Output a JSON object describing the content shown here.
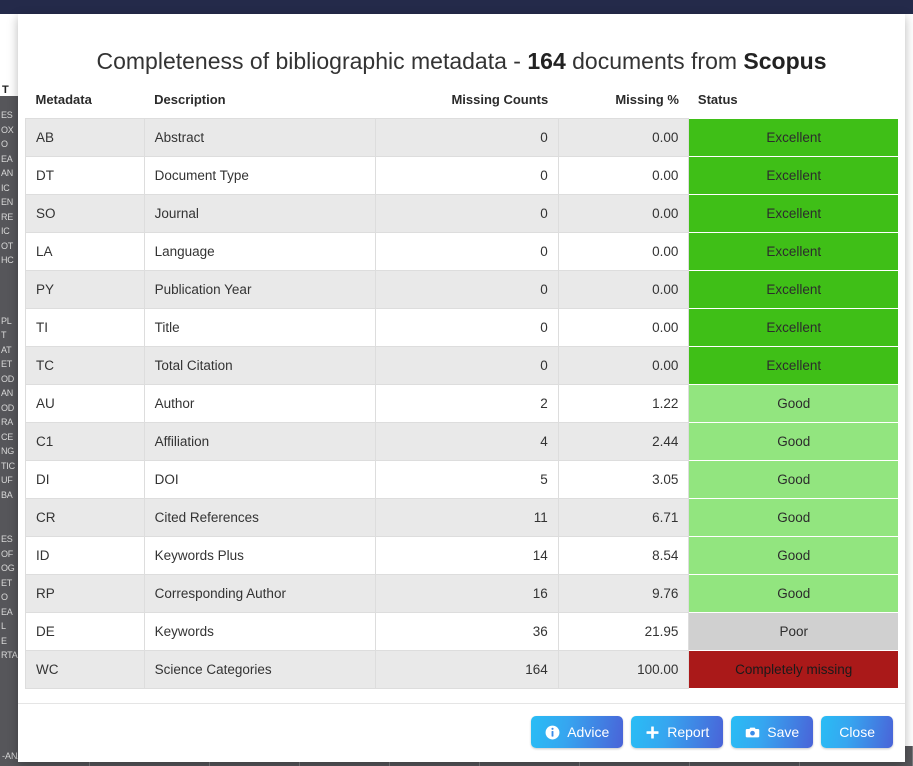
{
  "modal": {
    "title_prefix": "Completeness of bibliographic metadata - ",
    "title_count": "164",
    "title_mid": " documents from ",
    "title_source": "Scopus"
  },
  "table": {
    "columns": [
      "Metadata",
      "Description",
      "Missing Counts",
      "Missing %",
      "Status"
    ],
    "rows": [
      {
        "metadata": "AB",
        "description": "Abstract",
        "missing_counts": "0",
        "missing_pct": "0.00",
        "status": "Excellent",
        "color": "#3fbf17"
      },
      {
        "metadata": "DT",
        "description": "Document Type",
        "missing_counts": "0",
        "missing_pct": "0.00",
        "status": "Excellent",
        "color": "#3fbf17"
      },
      {
        "metadata": "SO",
        "description": "Journal",
        "missing_counts": "0",
        "missing_pct": "0.00",
        "status": "Excellent",
        "color": "#3fbf17"
      },
      {
        "metadata": "LA",
        "description": "Language",
        "missing_counts": "0",
        "missing_pct": "0.00",
        "status": "Excellent",
        "color": "#3fbf17"
      },
      {
        "metadata": "PY",
        "description": "Publication Year",
        "missing_counts": "0",
        "missing_pct": "0.00",
        "status": "Excellent",
        "color": "#3fbf17"
      },
      {
        "metadata": "TI",
        "description": "Title",
        "missing_counts": "0",
        "missing_pct": "0.00",
        "status": "Excellent",
        "color": "#3fbf17"
      },
      {
        "metadata": "TC",
        "description": "Total Citation",
        "missing_counts": "0",
        "missing_pct": "0.00",
        "status": "Excellent",
        "color": "#3fbf17"
      },
      {
        "metadata": "AU",
        "description": "Author",
        "missing_counts": "2",
        "missing_pct": "1.22",
        "status": "Good",
        "color": "#92e57f"
      },
      {
        "metadata": "C1",
        "description": "Affiliation",
        "missing_counts": "4",
        "missing_pct": "2.44",
        "status": "Good",
        "color": "#92e57f"
      },
      {
        "metadata": "DI",
        "description": "DOI",
        "missing_counts": "5",
        "missing_pct": "3.05",
        "status": "Good",
        "color": "#92e57f"
      },
      {
        "metadata": "CR",
        "description": "Cited References",
        "missing_counts": "11",
        "missing_pct": "6.71",
        "status": "Good",
        "color": "#92e57f"
      },
      {
        "metadata": "ID",
        "description": "Keywords Plus",
        "missing_counts": "14",
        "missing_pct": "8.54",
        "status": "Good",
        "color": "#92e57f"
      },
      {
        "metadata": "RP",
        "description": "Corresponding Author",
        "missing_counts": "16",
        "missing_pct": "9.76",
        "status": "Good",
        "color": "#92e57f"
      },
      {
        "metadata": "DE",
        "description": "Keywords",
        "missing_counts": "36",
        "missing_pct": "21.95",
        "status": "Poor",
        "color": "#d0d0d0"
      },
      {
        "metadata": "WC",
        "description": "Science Categories",
        "missing_counts": "164",
        "missing_pct": "100.00",
        "status": "Completely missing",
        "color": "#aa1919"
      }
    ]
  },
  "footer": {
    "buttons": [
      {
        "label": "Advice",
        "icon": "info-circle-icon"
      },
      {
        "label": "Report",
        "icon": "plus-icon"
      },
      {
        "label": "Save",
        "icon": "camera-icon"
      },
      {
        "label": "Close",
        "icon": ""
      }
    ]
  },
  "backdrop": {
    "hidden_heading": "T",
    "sidebar_lines_top": [
      "ES",
      "OX",
      "O",
      "EA",
      "AN",
      "IC",
      "EN",
      "RE",
      "IC",
      "OT",
      "HC"
    ],
    "sidebar_lines_mid": [
      "PL",
      "T",
      "AT",
      "ET",
      "OD",
      "AN",
      "OD",
      "RA",
      "CE",
      "NG",
      "TIC",
      "UF",
      "BA"
    ],
    "sidebar_lines_bottom": [
      "ES",
      "OF",
      "OG",
      "ET",
      "O",
      "EA",
      "L",
      "E",
      "RTA"
    ],
    "bottom_bar_label": "-ANALYSIS"
  }
}
